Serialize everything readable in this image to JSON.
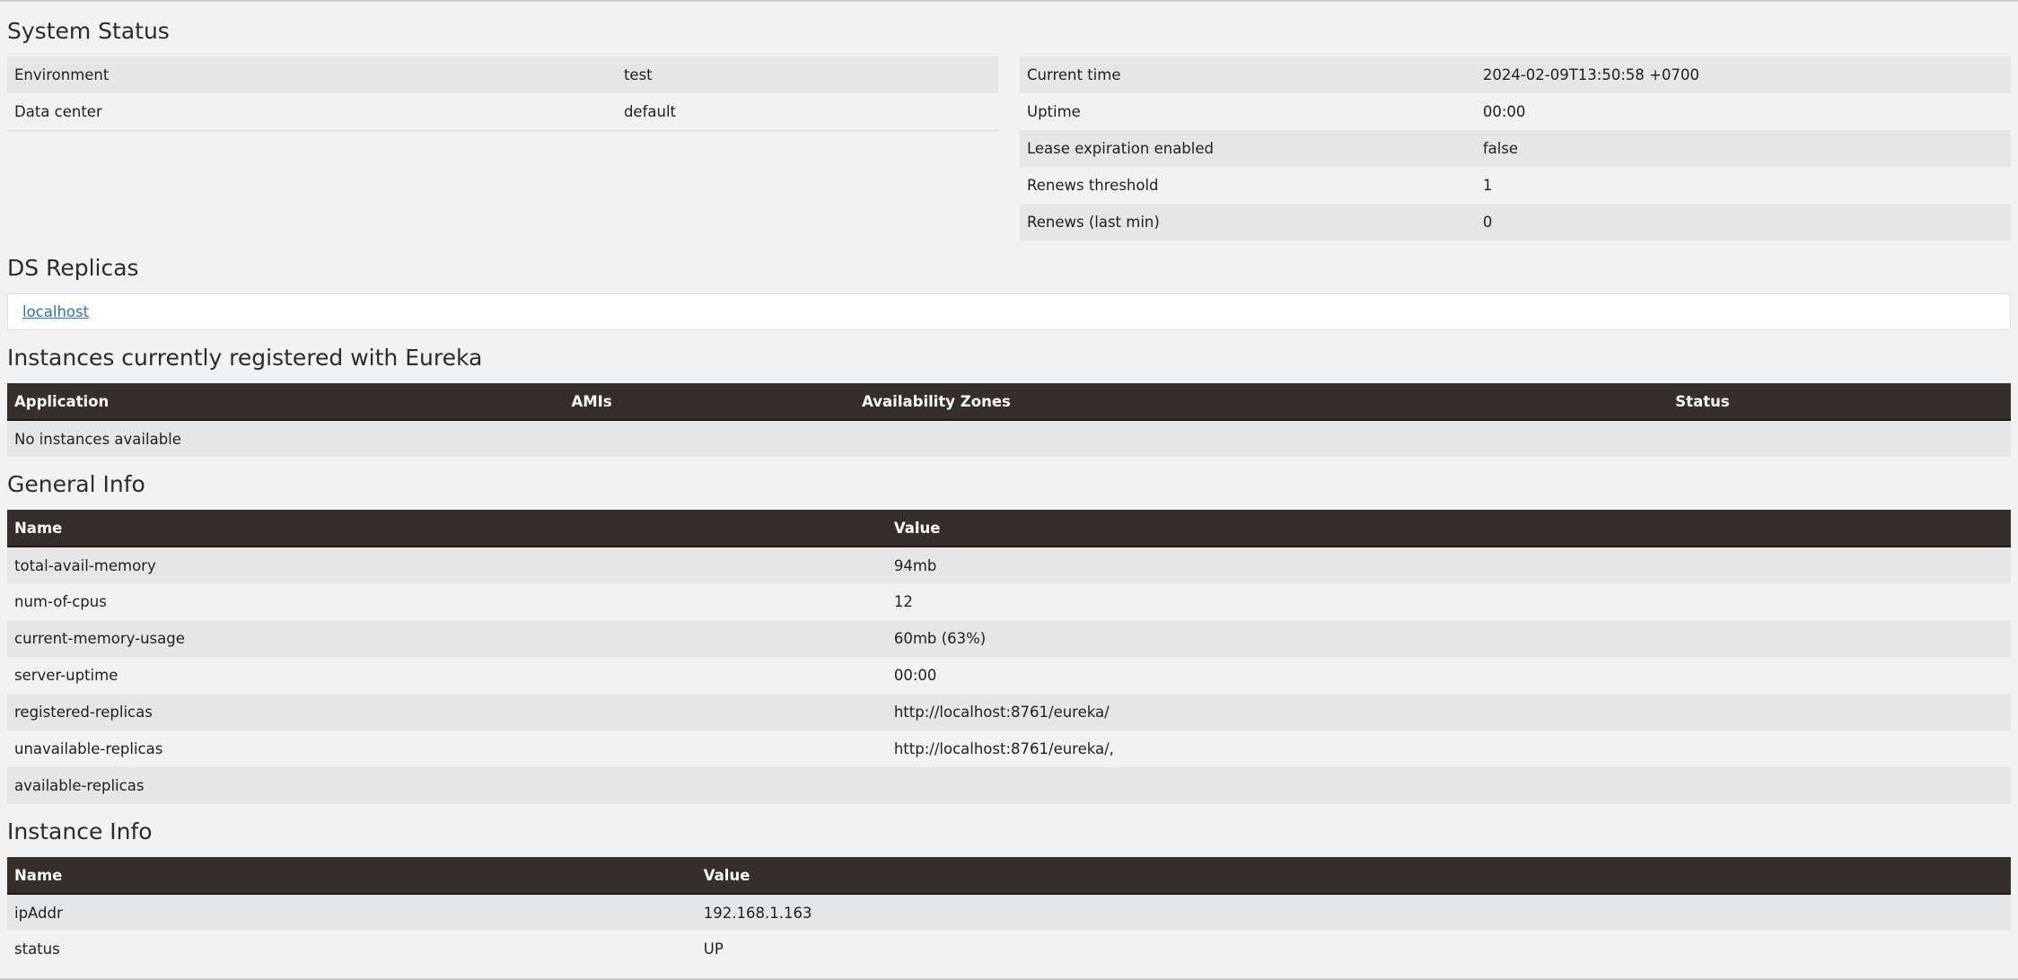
{
  "system_status": {
    "title": "System Status",
    "left": [
      {
        "label": "Environment",
        "value": "test"
      },
      {
        "label": "Data center",
        "value": "default"
      }
    ],
    "right": [
      {
        "label": "Current time",
        "value": "2024-02-09T13:50:58 +0700"
      },
      {
        "label": "Uptime",
        "value": "00:00"
      },
      {
        "label": "Lease expiration enabled",
        "value": "false"
      },
      {
        "label": "Renews threshold",
        "value": "1"
      },
      {
        "label": "Renews (last min)",
        "value": "0"
      }
    ]
  },
  "ds_replicas": {
    "title": "DS Replicas",
    "link": "localhost"
  },
  "instances": {
    "title": "Instances currently registered with Eureka",
    "headers": [
      "Application",
      "AMIs",
      "Availability Zones",
      "Status"
    ],
    "empty": "No instances available"
  },
  "general_info": {
    "title": "General Info",
    "headers": [
      "Name",
      "Value"
    ],
    "rows": [
      {
        "name": "total-avail-memory",
        "value": "94mb"
      },
      {
        "name": "num-of-cpus",
        "value": "12"
      },
      {
        "name": "current-memory-usage",
        "value": "60mb (63%)"
      },
      {
        "name": "server-uptime",
        "value": "00:00"
      },
      {
        "name": "registered-replicas",
        "value": "http://localhost:8761/eureka/"
      },
      {
        "name": "unavailable-replicas",
        "value": "http://localhost:8761/eureka/,"
      },
      {
        "name": "available-replicas",
        "value": ""
      }
    ]
  },
  "instance_info": {
    "title": "Instance Info",
    "headers": [
      "Name",
      "Value"
    ],
    "rows": [
      {
        "name": "ipAddr",
        "value": "192.168.1.163"
      },
      {
        "name": "status",
        "value": "UP"
      }
    ]
  }
}
